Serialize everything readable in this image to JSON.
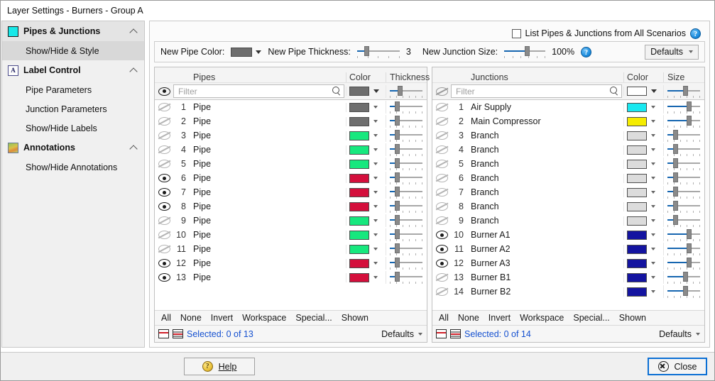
{
  "window": {
    "title": "Layer Settings - Burners - Group A"
  },
  "sidebar": {
    "groups": [
      {
        "label": "Pipes & Junctions",
        "icon": "cyan-square-icon",
        "items": [
          {
            "label": "Show/Hide & Style",
            "active": true
          }
        ]
      },
      {
        "label": "Label Control",
        "icon": "letter-a-icon",
        "items": [
          {
            "label": "Pipe Parameters",
            "active": false
          },
          {
            "label": "Junction Parameters",
            "active": false
          },
          {
            "label": "Show/Hide Labels",
            "active": false
          }
        ]
      },
      {
        "label": "Annotations",
        "icon": "picture-icon",
        "items": [
          {
            "label": "Show/Hide Annotations",
            "active": false
          }
        ]
      }
    ]
  },
  "topbar": {
    "all_scenarios_label": "List Pipes & Junctions from All Scenarios",
    "all_scenarios_checked": false,
    "help_glyph": "?"
  },
  "toolbar": {
    "new_pipe_color_label": "New Pipe Color:",
    "new_pipe_color": "#6e6e6e",
    "new_pipe_thickness_label": "New Pipe Thickness:",
    "new_pipe_thickness_value": "3",
    "new_pipe_thickness_pct": 22,
    "new_junction_size_label": "New Junction Size:",
    "new_junction_size_value": "100%",
    "new_junction_size_pct": 55,
    "help_glyph": "?",
    "defaults_label": "Defaults"
  },
  "pipes_panel": {
    "title": "Pipes",
    "color_header": "Color",
    "size_header": "Thickness",
    "header_visible": true,
    "header_color": "#6e6e6e",
    "header_size_pct": 30,
    "filter_placeholder": "Filter",
    "filter_value": "",
    "rows": [
      {
        "num": "1",
        "name": "Pipe",
        "visible": false,
        "color": "#6e6e6e",
        "size_pct": 22
      },
      {
        "num": "2",
        "name": "Pipe",
        "visible": false,
        "color": "#6e6e6e",
        "size_pct": 22
      },
      {
        "num": "3",
        "name": "Pipe",
        "visible": false,
        "color": "#17e87e",
        "size_pct": 22
      },
      {
        "num": "4",
        "name": "Pipe",
        "visible": false,
        "color": "#17e87e",
        "size_pct": 22
      },
      {
        "num": "5",
        "name": "Pipe",
        "visible": false,
        "color": "#17e87e",
        "size_pct": 22
      },
      {
        "num": "6",
        "name": "Pipe",
        "visible": true,
        "color": "#d40f3c",
        "size_pct": 22
      },
      {
        "num": "7",
        "name": "Pipe",
        "visible": true,
        "color": "#d40f3c",
        "size_pct": 22
      },
      {
        "num": "8",
        "name": "Pipe",
        "visible": true,
        "color": "#d40f3c",
        "size_pct": 22
      },
      {
        "num": "9",
        "name": "Pipe",
        "visible": false,
        "color": "#17e87e",
        "size_pct": 22
      },
      {
        "num": "10",
        "name": "Pipe",
        "visible": false,
        "color": "#17e87e",
        "size_pct": 22
      },
      {
        "num": "11",
        "name": "Pipe",
        "visible": false,
        "color": "#17e87e",
        "size_pct": 22
      },
      {
        "num": "12",
        "name": "Pipe",
        "visible": true,
        "color": "#d40f3c",
        "size_pct": 22
      },
      {
        "num": "13",
        "name": "Pipe",
        "visible": true,
        "color": "#d40f3c",
        "size_pct": 22
      }
    ],
    "actions": [
      "All",
      "None",
      "Invert",
      "Workspace",
      "Special...",
      "Shown"
    ],
    "selected_text": "Selected: 0 of 13",
    "defaults_label": "Defaults"
  },
  "junctions_panel": {
    "title": "Junctions",
    "color_header": "Color",
    "size_header": "Size",
    "header_visible": false,
    "header_color": "#ffffff",
    "header_size_pct": 55,
    "filter_placeholder": "Filter",
    "filter_value": "",
    "rows": [
      {
        "num": "1",
        "name": "Air Supply",
        "visible": false,
        "color": "#18e8f0",
        "size_pct": 66
      },
      {
        "num": "2",
        "name": "Main Compressor",
        "visible": false,
        "color": "#f5ec00",
        "size_pct": 66
      },
      {
        "num": "3",
        "name": "Branch",
        "visible": false,
        "color": "#dcdcdc",
        "size_pct": 24
      },
      {
        "num": "4",
        "name": "Branch",
        "visible": false,
        "color": "#dcdcdc",
        "size_pct": 24
      },
      {
        "num": "5",
        "name": "Branch",
        "visible": false,
        "color": "#dcdcdc",
        "size_pct": 24
      },
      {
        "num": "6",
        "name": "Branch",
        "visible": false,
        "color": "#dcdcdc",
        "size_pct": 24
      },
      {
        "num": "7",
        "name": "Branch",
        "visible": false,
        "color": "#dcdcdc",
        "size_pct": 24
      },
      {
        "num": "8",
        "name": "Branch",
        "visible": false,
        "color": "#dcdcdc",
        "size_pct": 24
      },
      {
        "num": "9",
        "name": "Branch",
        "visible": false,
        "color": "#dcdcdc",
        "size_pct": 24
      },
      {
        "num": "10",
        "name": "Burner A1",
        "visible": true,
        "color": "#1414a0",
        "size_pct": 66
      },
      {
        "num": "11",
        "name": "Burner A2",
        "visible": true,
        "color": "#1414a0",
        "size_pct": 66
      },
      {
        "num": "12",
        "name": "Burner A3",
        "visible": true,
        "color": "#1414a0",
        "size_pct": 66
      },
      {
        "num": "13",
        "name": "Burner B1",
        "visible": false,
        "color": "#1414a0",
        "size_pct": 55
      },
      {
        "num": "14",
        "name": "Burner B2",
        "visible": false,
        "color": "#1414a0",
        "size_pct": 55
      }
    ],
    "actions": [
      "All",
      "None",
      "Invert",
      "Workspace",
      "Special...",
      "Shown"
    ],
    "selected_text": "Selected: 0 of 14",
    "defaults_label": "Defaults"
  },
  "footer": {
    "help_label": "Help",
    "close_label": "Close"
  }
}
